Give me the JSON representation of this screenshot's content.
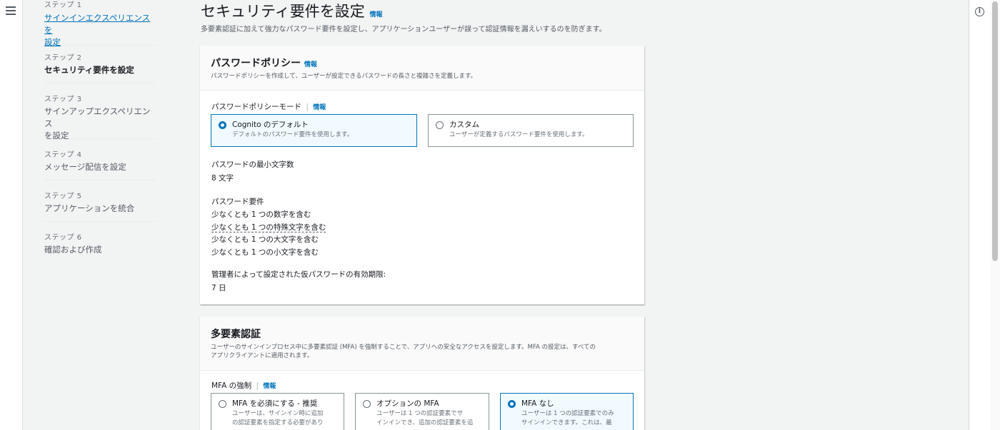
{
  "nav": {
    "steps": [
      {
        "label": "ステップ 1",
        "title_line1": "サインインエクスペリエンスを",
        "title_line2": "設定"
      },
      {
        "label": "ステップ 2",
        "title": "セキュリティ要件を設定"
      },
      {
        "label": "ステップ 3",
        "title_line1": "サインアップエクスペリエンス",
        "title_line2": "を設定"
      },
      {
        "label": "ステップ 4",
        "title": "メッセージ配信を設定"
      },
      {
        "label": "ステップ 5",
        "title": "アプリケーションを統合"
      },
      {
        "label": "ステップ 6",
        "title": "確認および作成"
      }
    ]
  },
  "page": {
    "title": "セキュリティ要件を設定",
    "info": "情報",
    "description": "多要素認証に加えて強力なパスワード要件を設定し、アプリケーションユーザーが誤って認証情報を漏えいするのを防ぎます。"
  },
  "password_policy": {
    "title": "パスワードポリシー",
    "info": "情報",
    "description": "パスワードポリシーを作成して、ユーザーが設定できるパスワードの長さと複雑さを定義します。",
    "mode_label": "パスワードポリシーモード",
    "mode_info": "情報",
    "options": [
      {
        "title": "Cognito のデフォルト",
        "desc": "デフォルトのパスワード要件を使用します。",
        "selected": true
      },
      {
        "title": "カスタム",
        "desc": "ユーザーが定義するパスワード要件を使用します。",
        "selected": false
      }
    ],
    "min_length_label": "パスワードの最小文字数",
    "min_length_value": "8 文字",
    "requirements_label": "パスワード要件",
    "requirements": [
      "少なくとも 1 つの数字を含む",
      "少なくとも 1 つの特殊文字を含む",
      "少なくとも 1 つの大文字を含む",
      "少なくとも 1 つの小文字を含む"
    ],
    "temp_expiry_label": "管理者によって設定された仮パスワードの有効期限:",
    "temp_expiry_value": "7 日"
  },
  "mfa": {
    "title": "多要素認証",
    "description_line1": "ユーザーのサインインプロセス中に多要素認証 (MFA) を強制することで、アプリへの安全なアクセスを設定します。MFA の設定は、すべての",
    "description_line2": "アプリクライアントに適用されます。",
    "enforcement_label": "MFA の強制",
    "enforcement_info": "情報",
    "options": [
      {
        "title": "MFA を必須にする - 推奨",
        "desc_line1": "ユーザーは、サインイン時に追加",
        "desc_line2": "の認証要素を指定する必要があり",
        "selected": false
      },
      {
        "title": "オプションの MFA",
        "desc_line1": "ユーザーは 1 つの認証要素でサ",
        "desc_line2": "インインでき、追加の認証要素を追",
        "selected": false
      },
      {
        "title": "MFA なし",
        "desc_line1": "ユーザーは 1 つの認証要素でのみ",
        "desc_line2": "サインインできます。これは、最",
        "selected": true
      }
    ]
  },
  "icons": {
    "menu": "hamburger-menu-icon",
    "info": "info-circle-icon"
  },
  "colors": {
    "link": "#0073bb",
    "background": "#f2f3f3",
    "selected_tile_bg": "#f1faff"
  }
}
